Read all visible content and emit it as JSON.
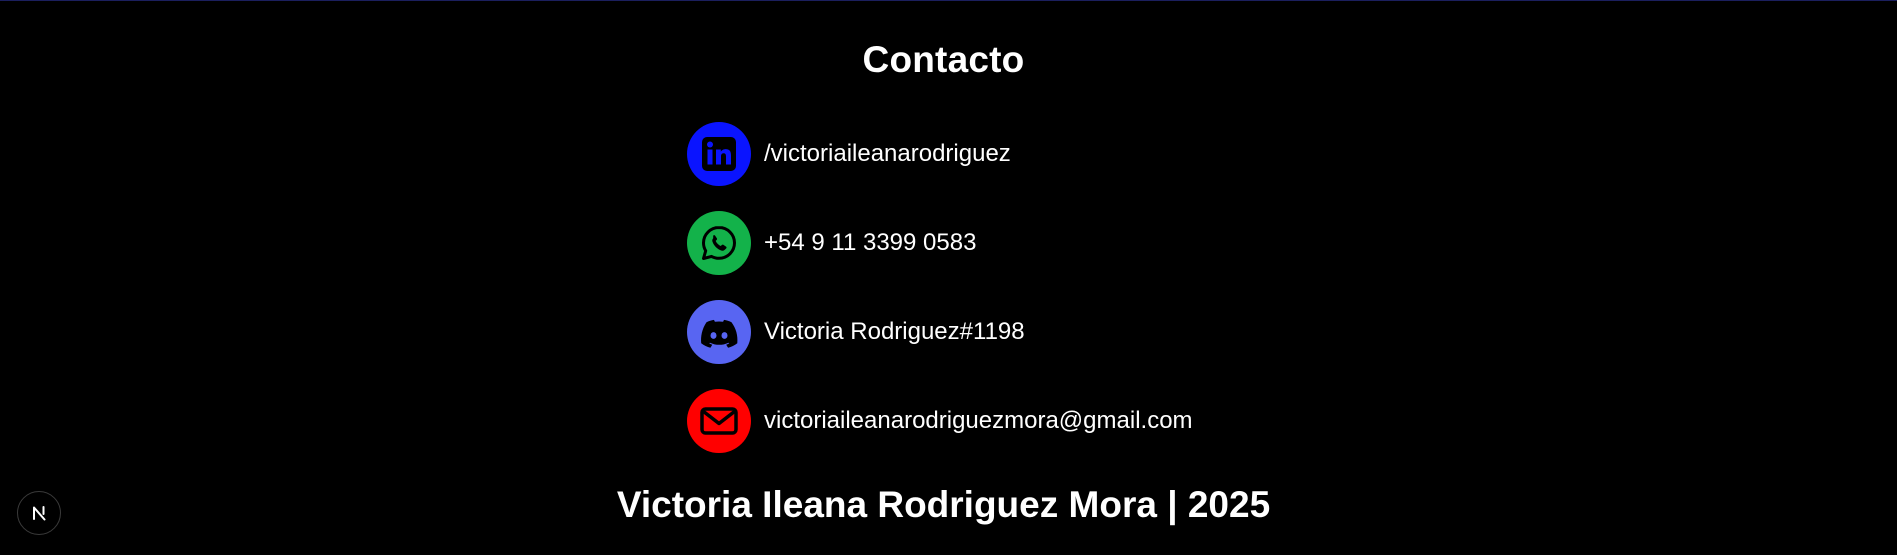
{
  "contact": {
    "title": "Contacto",
    "items": [
      {
        "icon": "linkedin-icon",
        "color": "#0a14ff",
        "text": "/victoriaileanarodriguez"
      },
      {
        "icon": "whatsapp-icon",
        "color": "#13b24a",
        "text": "+54 9 11 3399 0583"
      },
      {
        "icon": "discord-icon",
        "color": "#5865f2",
        "text": "Victoria Rodriguez#1198"
      },
      {
        "icon": "mail-icon",
        "color": "#ff0000",
        "text": "victoriaileanarodriguezmora@gmail.com"
      }
    ]
  },
  "footer": {
    "text": "Victoria Ileana Rodriguez Mora | 2025"
  },
  "dev_badge": {
    "icon": "nextjs-icon",
    "letter": "N"
  }
}
